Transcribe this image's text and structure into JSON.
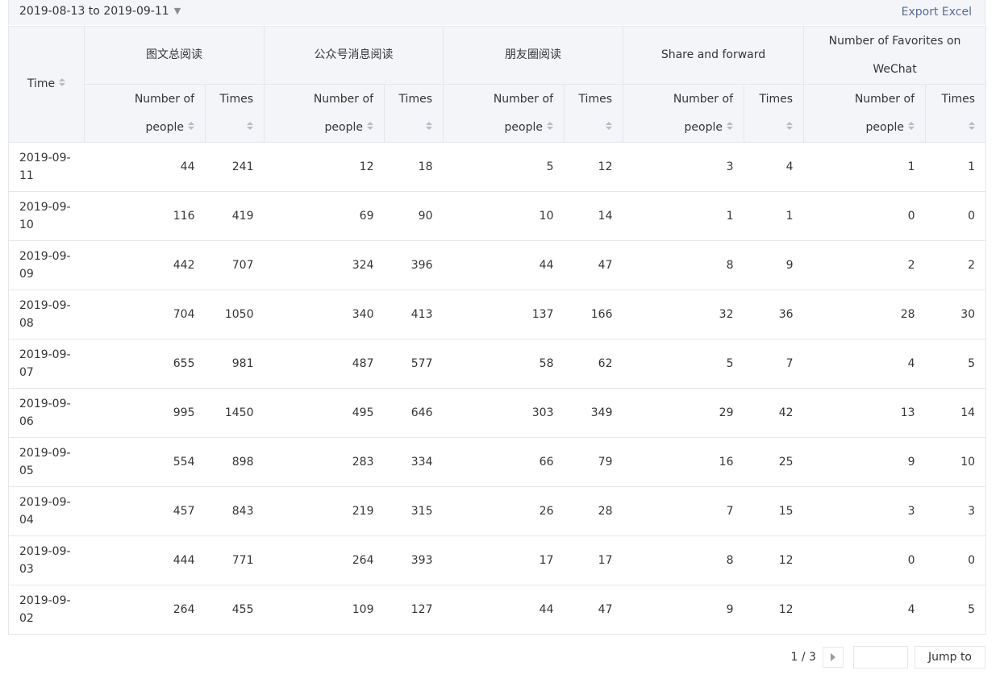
{
  "toolbar": {
    "date_range": "2019-08-13 to 2019-09-11",
    "export_label": "Export Excel"
  },
  "table": {
    "time_header": "Time",
    "groups": [
      "图文总阅读",
      "公众号消息阅读",
      "朋友圈阅读",
      "Share and forward",
      "Number of Favorites on WeChat"
    ],
    "sub_people": "Number of people",
    "sub_times": "Times",
    "rows": [
      {
        "date": "2019-09-11",
        "values": [
          "44",
          "241",
          "12",
          "18",
          "5",
          "12",
          "3",
          "4",
          "1",
          "1"
        ]
      },
      {
        "date": "2019-09-10",
        "values": [
          "116",
          "419",
          "69",
          "90",
          "10",
          "14",
          "1",
          "1",
          "0",
          "0"
        ]
      },
      {
        "date": "2019-09-09",
        "values": [
          "442",
          "707",
          "324",
          "396",
          "44",
          "47",
          "8",
          "9",
          "2",
          "2"
        ]
      },
      {
        "date": "2019-09-08",
        "values": [
          "704",
          "1050",
          "340",
          "413",
          "137",
          "166",
          "32",
          "36",
          "28",
          "30"
        ]
      },
      {
        "date": "2019-09-07",
        "values": [
          "655",
          "981",
          "487",
          "577",
          "58",
          "62",
          "5",
          "7",
          "4",
          "5"
        ]
      },
      {
        "date": "2019-09-06",
        "values": [
          "995",
          "1450",
          "495",
          "646",
          "303",
          "349",
          "29",
          "42",
          "13",
          "14"
        ]
      },
      {
        "date": "2019-09-05",
        "values": [
          "554",
          "898",
          "283",
          "334",
          "66",
          "79",
          "16",
          "25",
          "9",
          "10"
        ]
      },
      {
        "date": "2019-09-04",
        "values": [
          "457",
          "843",
          "219",
          "315",
          "26",
          "28",
          "7",
          "15",
          "3",
          "3"
        ]
      },
      {
        "date": "2019-09-03",
        "values": [
          "444",
          "771",
          "264",
          "393",
          "17",
          "17",
          "8",
          "12",
          "0",
          "0"
        ]
      },
      {
        "date": "2019-09-02",
        "values": [
          "264",
          "455",
          "109",
          "127",
          "44",
          "47",
          "9",
          "12",
          "4",
          "5"
        ]
      }
    ]
  },
  "pagination": {
    "page_info": "1 / 3",
    "jump_input_value": "",
    "jump_label": "Jump to"
  }
}
